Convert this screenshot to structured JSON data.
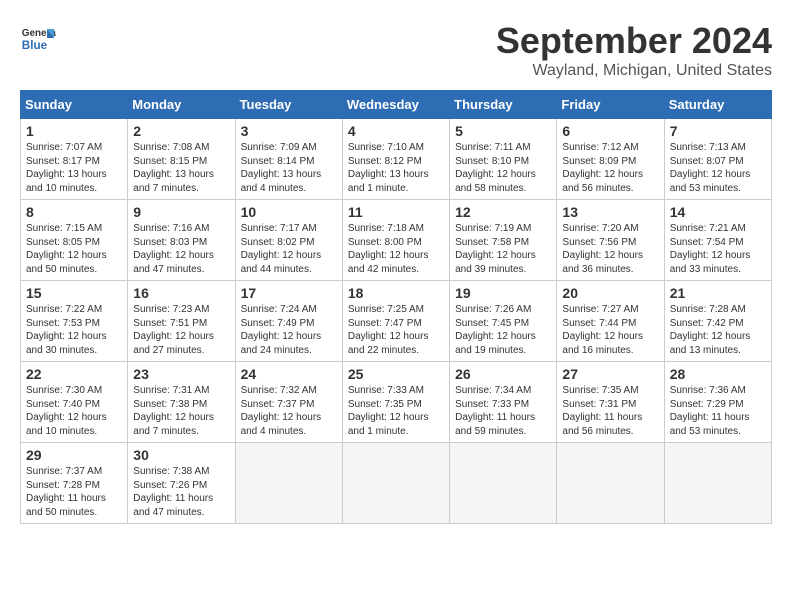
{
  "header": {
    "logo_line1": "General",
    "logo_line2": "Blue",
    "month": "September 2024",
    "location": "Wayland, Michigan, United States"
  },
  "days_of_week": [
    "Sunday",
    "Monday",
    "Tuesday",
    "Wednesday",
    "Thursday",
    "Friday",
    "Saturday"
  ],
  "weeks": [
    [
      {
        "day": "1",
        "info": "Sunrise: 7:07 AM\nSunset: 8:17 PM\nDaylight: 13 hours\nand 10 minutes."
      },
      {
        "day": "2",
        "info": "Sunrise: 7:08 AM\nSunset: 8:15 PM\nDaylight: 13 hours\nand 7 minutes."
      },
      {
        "day": "3",
        "info": "Sunrise: 7:09 AM\nSunset: 8:14 PM\nDaylight: 13 hours\nand 4 minutes."
      },
      {
        "day": "4",
        "info": "Sunrise: 7:10 AM\nSunset: 8:12 PM\nDaylight: 13 hours\nand 1 minute."
      },
      {
        "day": "5",
        "info": "Sunrise: 7:11 AM\nSunset: 8:10 PM\nDaylight: 12 hours\nand 58 minutes."
      },
      {
        "day": "6",
        "info": "Sunrise: 7:12 AM\nSunset: 8:09 PM\nDaylight: 12 hours\nand 56 minutes."
      },
      {
        "day": "7",
        "info": "Sunrise: 7:13 AM\nSunset: 8:07 PM\nDaylight: 12 hours\nand 53 minutes."
      }
    ],
    [
      {
        "day": "8",
        "info": "Sunrise: 7:15 AM\nSunset: 8:05 PM\nDaylight: 12 hours\nand 50 minutes."
      },
      {
        "day": "9",
        "info": "Sunrise: 7:16 AM\nSunset: 8:03 PM\nDaylight: 12 hours\nand 47 minutes."
      },
      {
        "day": "10",
        "info": "Sunrise: 7:17 AM\nSunset: 8:02 PM\nDaylight: 12 hours\nand 44 minutes."
      },
      {
        "day": "11",
        "info": "Sunrise: 7:18 AM\nSunset: 8:00 PM\nDaylight: 12 hours\nand 42 minutes."
      },
      {
        "day": "12",
        "info": "Sunrise: 7:19 AM\nSunset: 7:58 PM\nDaylight: 12 hours\nand 39 minutes."
      },
      {
        "day": "13",
        "info": "Sunrise: 7:20 AM\nSunset: 7:56 PM\nDaylight: 12 hours\nand 36 minutes."
      },
      {
        "day": "14",
        "info": "Sunrise: 7:21 AM\nSunset: 7:54 PM\nDaylight: 12 hours\nand 33 minutes."
      }
    ],
    [
      {
        "day": "15",
        "info": "Sunrise: 7:22 AM\nSunset: 7:53 PM\nDaylight: 12 hours\nand 30 minutes."
      },
      {
        "day": "16",
        "info": "Sunrise: 7:23 AM\nSunset: 7:51 PM\nDaylight: 12 hours\nand 27 minutes."
      },
      {
        "day": "17",
        "info": "Sunrise: 7:24 AM\nSunset: 7:49 PM\nDaylight: 12 hours\nand 24 minutes."
      },
      {
        "day": "18",
        "info": "Sunrise: 7:25 AM\nSunset: 7:47 PM\nDaylight: 12 hours\nand 22 minutes."
      },
      {
        "day": "19",
        "info": "Sunrise: 7:26 AM\nSunset: 7:45 PM\nDaylight: 12 hours\nand 19 minutes."
      },
      {
        "day": "20",
        "info": "Sunrise: 7:27 AM\nSunset: 7:44 PM\nDaylight: 12 hours\nand 16 minutes."
      },
      {
        "day": "21",
        "info": "Sunrise: 7:28 AM\nSunset: 7:42 PM\nDaylight: 12 hours\nand 13 minutes."
      }
    ],
    [
      {
        "day": "22",
        "info": "Sunrise: 7:30 AM\nSunset: 7:40 PM\nDaylight: 12 hours\nand 10 minutes."
      },
      {
        "day": "23",
        "info": "Sunrise: 7:31 AM\nSunset: 7:38 PM\nDaylight: 12 hours\nand 7 minutes."
      },
      {
        "day": "24",
        "info": "Sunrise: 7:32 AM\nSunset: 7:37 PM\nDaylight: 12 hours\nand 4 minutes."
      },
      {
        "day": "25",
        "info": "Sunrise: 7:33 AM\nSunset: 7:35 PM\nDaylight: 12 hours\nand 1 minute."
      },
      {
        "day": "26",
        "info": "Sunrise: 7:34 AM\nSunset: 7:33 PM\nDaylight: 11 hours\nand 59 minutes."
      },
      {
        "day": "27",
        "info": "Sunrise: 7:35 AM\nSunset: 7:31 PM\nDaylight: 11 hours\nand 56 minutes."
      },
      {
        "day": "28",
        "info": "Sunrise: 7:36 AM\nSunset: 7:29 PM\nDaylight: 11 hours\nand 53 minutes."
      }
    ],
    [
      {
        "day": "29",
        "info": "Sunrise: 7:37 AM\nSunset: 7:28 PM\nDaylight: 11 hours\nand 50 minutes."
      },
      {
        "day": "30",
        "info": "Sunrise: 7:38 AM\nSunset: 7:26 PM\nDaylight: 11 hours\nand 47 minutes."
      },
      {
        "day": "",
        "info": ""
      },
      {
        "day": "",
        "info": ""
      },
      {
        "day": "",
        "info": ""
      },
      {
        "day": "",
        "info": ""
      },
      {
        "day": "",
        "info": ""
      }
    ]
  ]
}
